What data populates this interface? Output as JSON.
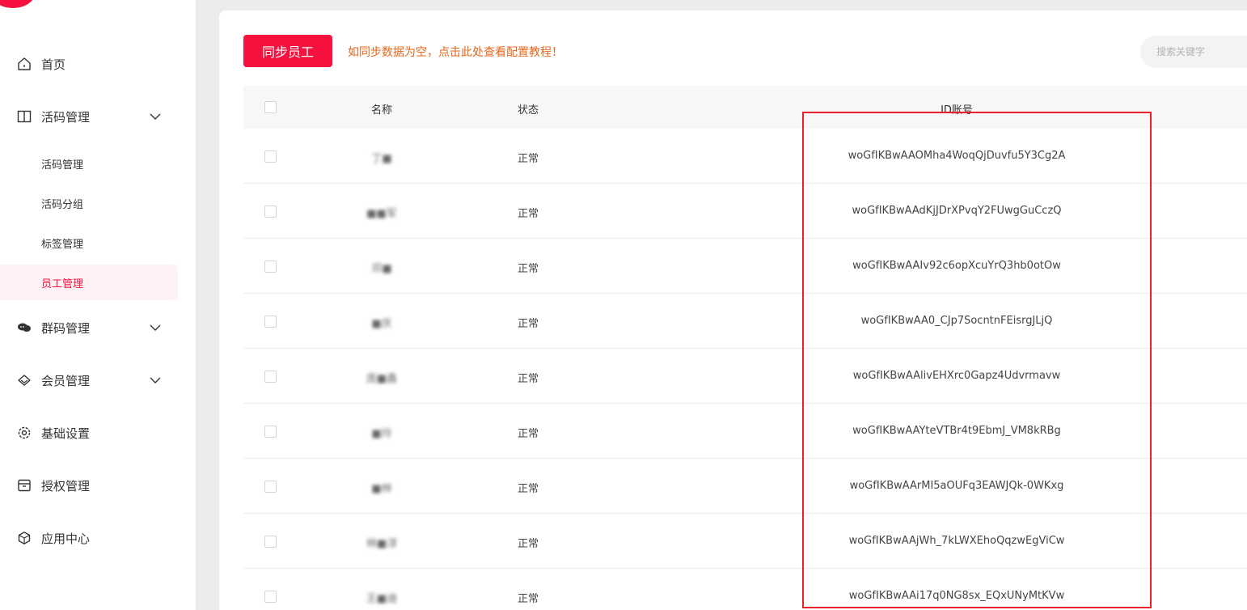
{
  "brand": {
    "accent": "#f5123f",
    "hint_color": "#e8661a",
    "highlight": "#e8212c"
  },
  "sidebar": {
    "items": [
      {
        "label": "首页",
        "icon": "home-icon"
      },
      {
        "label": "活码管理",
        "icon": "book-icon",
        "expanded": true
      },
      {
        "label": "群码管理",
        "icon": "chat-icon"
      },
      {
        "label": "会员管理",
        "icon": "diamond-icon"
      },
      {
        "label": "基础设置",
        "icon": "gear-icon"
      },
      {
        "label": "授权管理",
        "icon": "archive-icon"
      },
      {
        "label": "应用中心",
        "icon": "cube-icon"
      }
    ],
    "sub_items": [
      {
        "label": "活码管理"
      },
      {
        "label": "活码分组"
      },
      {
        "label": "标签管理"
      },
      {
        "label": "员工管理",
        "active": true
      }
    ]
  },
  "toolbar": {
    "sync_label": "同步员工",
    "hint": "如同步数据为空，点击此处查看配置教程！",
    "search_placeholder": "搜索关键字"
  },
  "table": {
    "headers": {
      "name": "名称",
      "status": "状态",
      "id": "ID账号"
    },
    "rows": [
      {
        "name": "丁■",
        "status": "正常",
        "id": "woGfIKBwAAOMha4WoqQjDuvfu5Y3Cg2A"
      },
      {
        "name": "■■军",
        "status": "正常",
        "id": "woGfIKBwAAdKjJDrXPvqY2FUwgGuCczQ"
      },
      {
        "name": "邓■",
        "status": "正常",
        "id": "woGfIKBwAAIv92c6opXcuYrQ3hb0otOw"
      },
      {
        "name": "■庆",
        "status": "正常",
        "id": "woGfIKBwAA0_CJp7SocntnFEisrgJLjQ"
      },
      {
        "name": "庞■鑫",
        "status": "正常",
        "id": "woGfIKBwAAlivEHXrc0Gapz4Udvrmavw"
      },
      {
        "name": "■玲",
        "status": "正常",
        "id": "woGfIKBwAAYteVTBr4t9EbmJ_VM8kRBg"
      },
      {
        "name": "■林",
        "status": "正常",
        "id": "woGfIKBwAArMI5aOUFq3EAWJQk-0WKxg"
      },
      {
        "name": "林■淳",
        "status": "正常",
        "id": "woGfIKBwAAjWh_7kLWXEhoQqzwEgViCw"
      },
      {
        "name": "王■迪",
        "status": "正常",
        "id": "woGfIKBwAAi17q0NG8sx_EQxUNyMtKVw"
      }
    ]
  }
}
